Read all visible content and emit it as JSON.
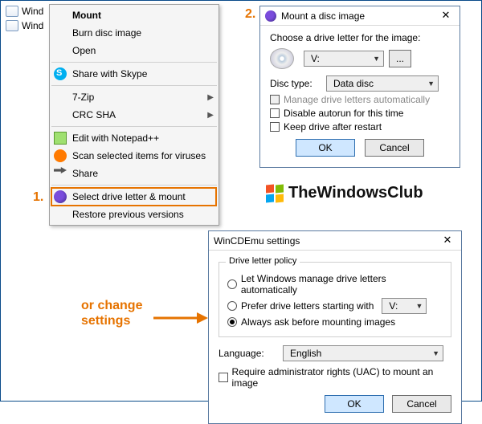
{
  "files": {
    "row1": "Wind",
    "row2": "Wind"
  },
  "context_menu": {
    "items": [
      {
        "label": "Mount",
        "bold": true
      },
      {
        "label": "Burn disc image"
      },
      {
        "label": "Open"
      },
      {
        "label": "Share with Skype",
        "icon": "skype"
      },
      {
        "label": "7-Zip",
        "submenu": true
      },
      {
        "label": "CRC SHA",
        "submenu": true
      },
      {
        "label": "Edit with Notepad++",
        "icon": "np"
      },
      {
        "label": "Scan selected items for viruses",
        "icon": "av"
      },
      {
        "label": "Share",
        "icon": "share"
      },
      {
        "label": "Select drive letter & mount",
        "icon": "disc",
        "highlighted": true
      },
      {
        "label": "Restore previous versions"
      }
    ]
  },
  "annotations": {
    "num1": "1.",
    "num2": "2.",
    "change_line1": "or change",
    "change_line2": "settings"
  },
  "mount_dialog": {
    "title": "Mount a disc image",
    "choose_label": "Choose a drive letter for the image:",
    "drive_letter": "V:",
    "more_btn": "...",
    "disc_type_label": "Disc type:",
    "disc_type_value": "Data disc",
    "opt_manage": "Manage drive letters automatically",
    "opt_disable": "Disable autorun for this time",
    "opt_keep": "Keep drive after restart",
    "ok": "OK",
    "cancel": "Cancel"
  },
  "settings_dialog": {
    "title": "WinCDEmu settings",
    "group_title": "Drive letter policy",
    "opt_auto": "Let Windows manage drive letters automatically",
    "opt_prefer": "Prefer drive letters starting with",
    "prefer_value": "V:",
    "opt_ask": "Always ask before mounting images",
    "lang_label": "Language:",
    "lang_value": "English",
    "opt_uac": "Require administrator rights (UAC) to mount an image",
    "ok": "OK",
    "cancel": "Cancel"
  },
  "logo": {
    "text": "TheWindowsClub"
  }
}
